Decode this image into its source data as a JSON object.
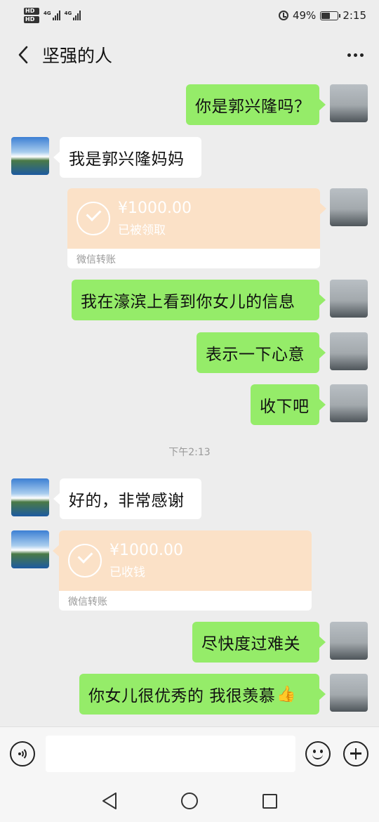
{
  "status_bar": {
    "hd1": "HD",
    "hd2": "HD",
    "net1": "4G",
    "net2": "4G",
    "battery": "49%",
    "time": "2:15"
  },
  "header": {
    "title": "坚强的人",
    "back_icon": "back-arrow-icon",
    "more_icon": "more-icon"
  },
  "messages": [
    {
      "side": "self",
      "type": "text",
      "text": "你是郭兴隆吗？"
    },
    {
      "side": "other",
      "type": "text",
      "text": "我是郭兴隆妈妈"
    },
    {
      "side": "self",
      "type": "transfer",
      "amount": "¥1000.00",
      "status": "已被领取",
      "label": "微信转账"
    },
    {
      "side": "self",
      "type": "text",
      "text": "我在濠滨上看到你女儿的信息"
    },
    {
      "side": "self",
      "type": "text",
      "text": "表示一下心意"
    },
    {
      "side": "self",
      "type": "text",
      "text": "收下吧"
    },
    {
      "side": "other",
      "type": "text",
      "text": "好的，非常感谢"
    },
    {
      "side": "other",
      "type": "transfer",
      "amount": "¥1000.00",
      "status": "已收钱",
      "label": "微信转账"
    },
    {
      "side": "self",
      "type": "text",
      "text": "尽快度过难关"
    },
    {
      "side": "self",
      "type": "text",
      "text": "你女儿很优秀的 我很羡慕",
      "emoji": "👍"
    }
  ],
  "timestamp": "下午2:13",
  "input_bar": {
    "voice_icon": "voice-icon",
    "input_value": "",
    "emoji_icon": "emoji-icon",
    "plus_icon": "plus-icon"
  },
  "nav_bar": {
    "back": "nav-back-icon",
    "home": "nav-home-icon",
    "recents": "nav-recents-icon"
  },
  "colors": {
    "self_bubble": "#95ec69",
    "other_bubble": "#ffffff",
    "transfer_bg": "#fbe1c7",
    "chat_bg": "#ededed"
  }
}
